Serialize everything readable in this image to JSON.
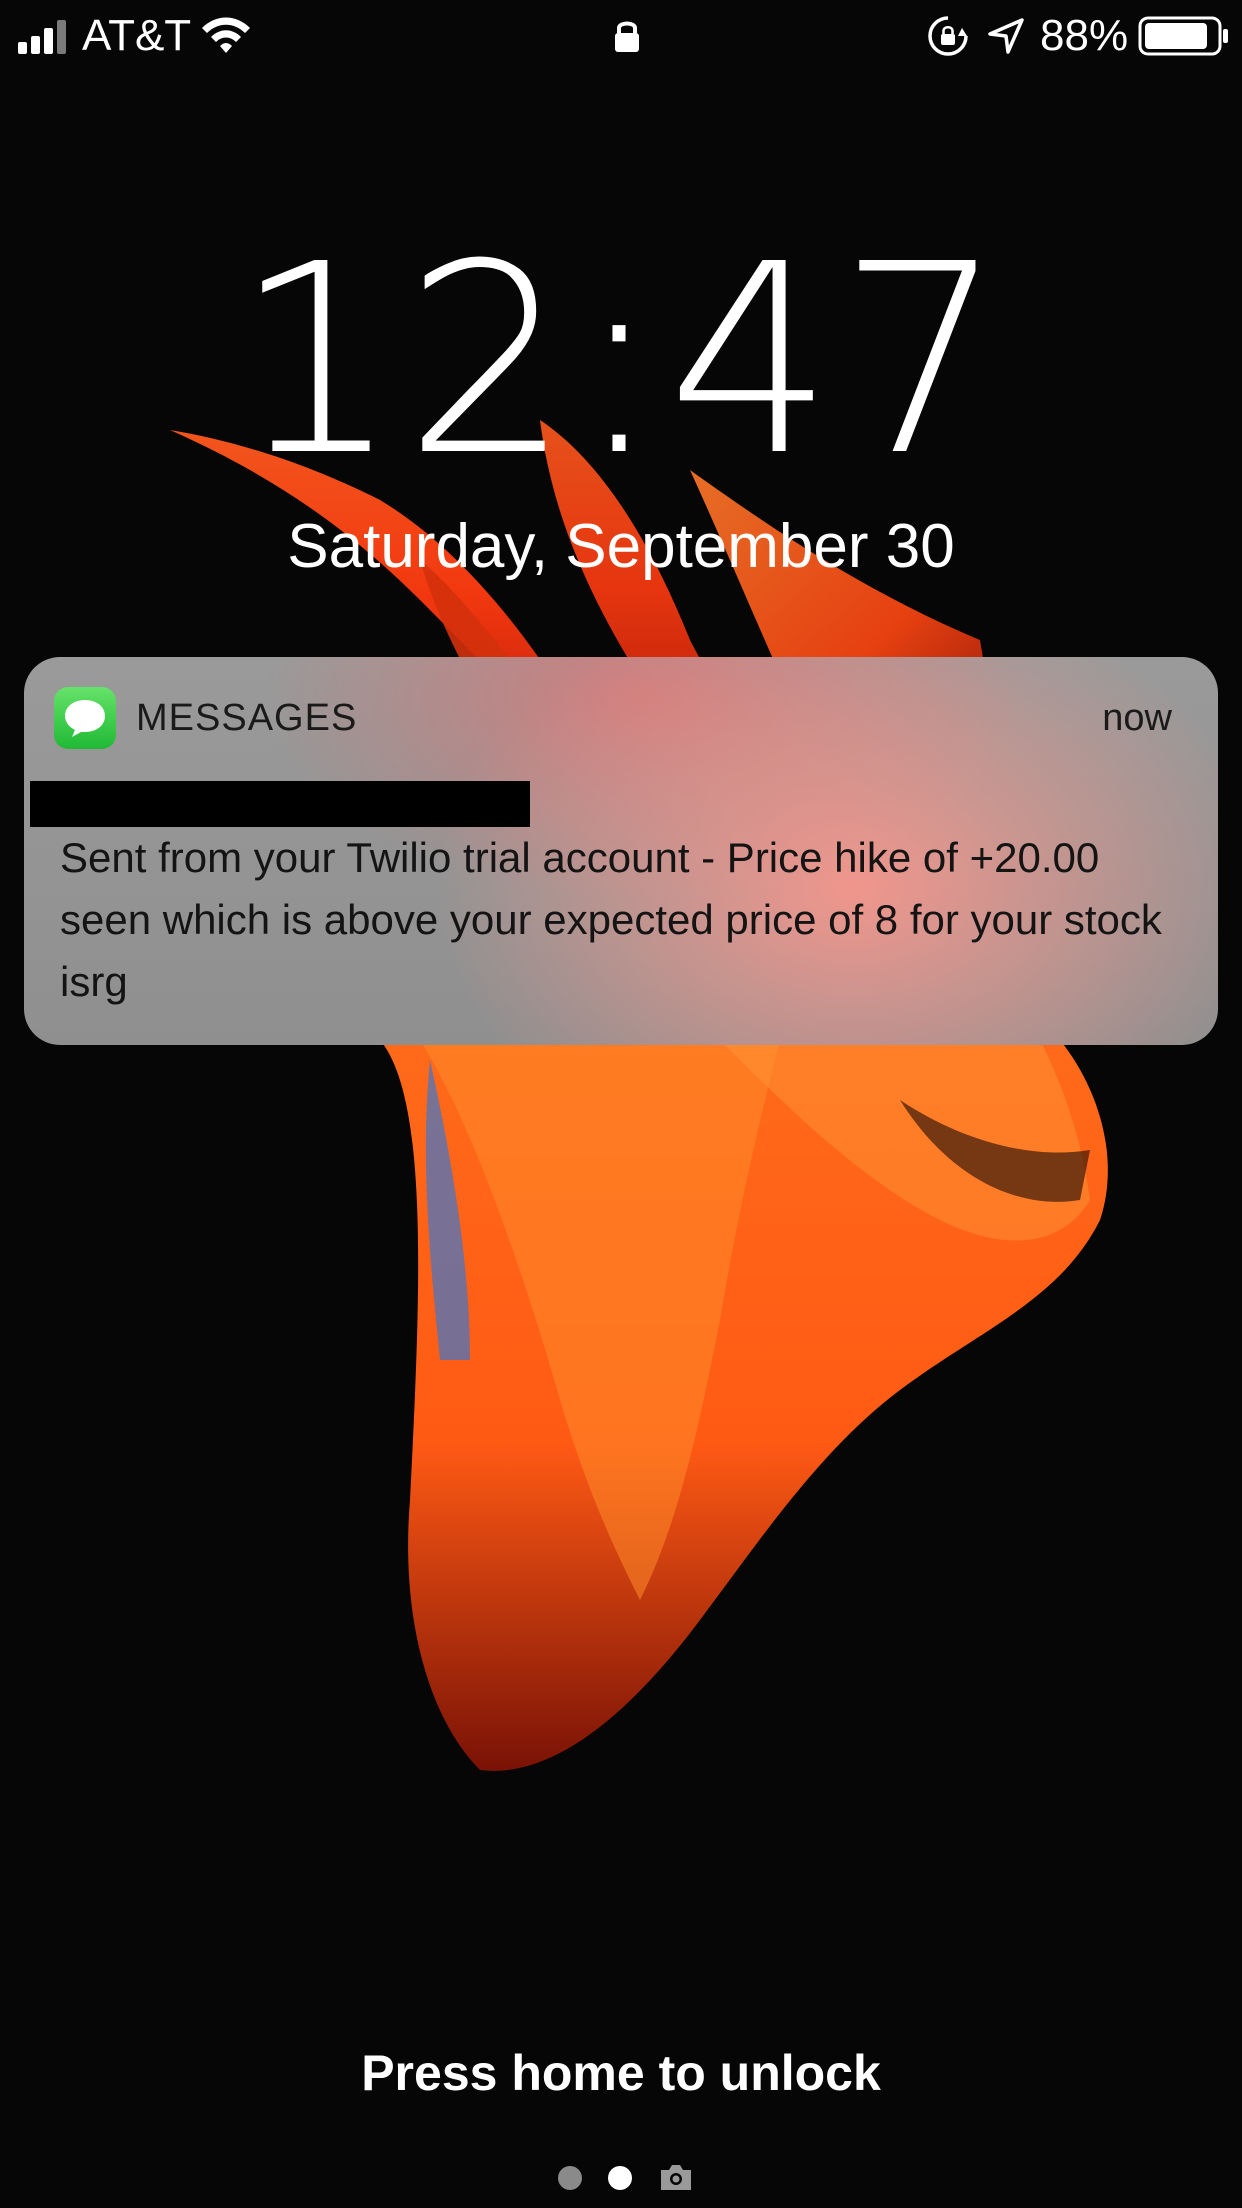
{
  "status_bar": {
    "carrier": "AT&T",
    "battery_percent_label": "88%",
    "battery_level": 0.88,
    "icons": [
      "signal-icon",
      "wifi-icon",
      "lock-icon",
      "rotation-lock-icon",
      "location-icon",
      "battery-icon"
    ]
  },
  "lock_screen": {
    "time": "12:47",
    "date": "Saturday, September 30",
    "unlock_hint": "Press home to unlock",
    "page_indicator": {
      "pages": 2,
      "current": 2,
      "extra_icon": "camera-icon"
    }
  },
  "notification": {
    "app_name": "MESSAGES",
    "app_icon": "messages-icon",
    "time": "now",
    "sender_redacted": true,
    "body": "Sent from your Twilio trial account - Price hike of +20.00 seen which is above your expected price of 8 for your stock isrg"
  },
  "colors": {
    "background": "#060606",
    "wallpaper_accent": "#ff4a12",
    "messages_green": "#34c759",
    "notification_bg": "#999999"
  }
}
